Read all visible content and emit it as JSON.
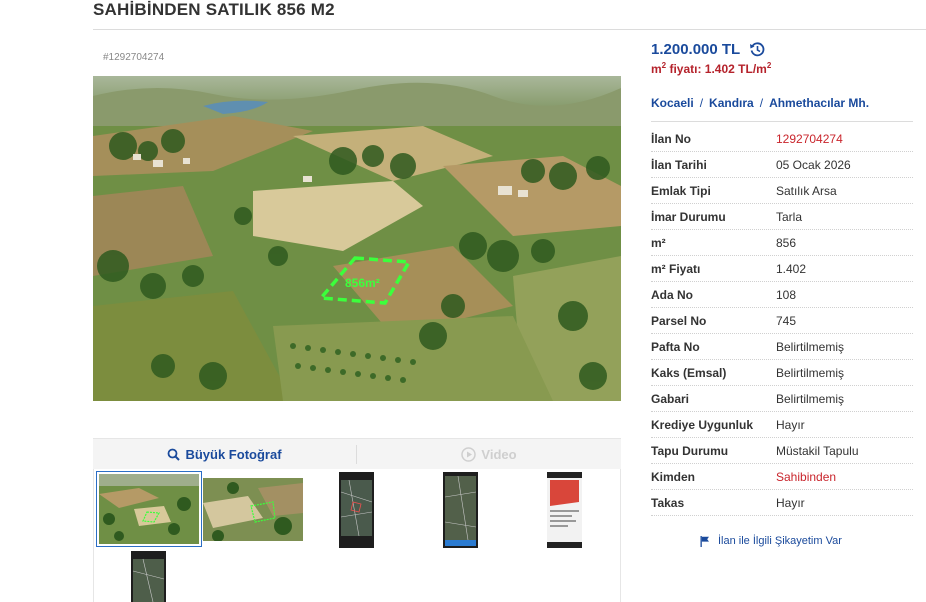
{
  "listing": {
    "title": "SAHİBİNDEN SATILIK 856 M2",
    "code": "#1292704274"
  },
  "photo": {
    "overlay_label": "856m²",
    "description_icon": "aerial-land-photo"
  },
  "media": {
    "photo_button": "Büyük Fotoğraf",
    "video_button": "Video",
    "photo_icon": "search-icon",
    "video_icon": "play-circle-icon"
  },
  "thumbnails": [
    {
      "kind": "aerial",
      "selected": true
    },
    {
      "kind": "aerial-closeup",
      "selected": false
    },
    {
      "kind": "phone-map",
      "selected": false
    },
    {
      "kind": "phone-map",
      "selected": false
    },
    {
      "kind": "phone-parcel",
      "selected": false
    },
    {
      "kind": "phone-map",
      "selected": false
    }
  ],
  "price": {
    "amount": "1.200.000 TL",
    "history_icon": "history-icon",
    "sqm_prefix": "m",
    "sqm_sup": "2",
    "sqm_text": " fiyatı: 1.402 TL/m",
    "sqm_sup2": "2"
  },
  "location": {
    "city": "Kocaeli",
    "district": "Kandıra",
    "neighborhood": "Ahmethacılar Mh.",
    "separator": "/"
  },
  "details": [
    {
      "label": "İlan No",
      "value": "1292704274",
      "highlight": true
    },
    {
      "label": "İlan Tarihi",
      "value": "05 Ocak 2026",
      "highlight": false
    },
    {
      "label": "Emlak Tipi",
      "value": "Satılık Arsa",
      "highlight": false
    },
    {
      "label": "İmar Durumu",
      "value": "Tarla",
      "highlight": false
    },
    {
      "label": "m²",
      "value": "856",
      "highlight": false
    },
    {
      "label": "m² Fiyatı",
      "value": "1.402",
      "highlight": false
    },
    {
      "label": "Ada No",
      "value": "108",
      "highlight": false
    },
    {
      "label": "Parsel No",
      "value": "745",
      "highlight": false
    },
    {
      "label": "Pafta No",
      "value": "Belirtilmemiş",
      "highlight": false
    },
    {
      "label": "Kaks (Emsal)",
      "value": "Belirtilmemiş",
      "highlight": false
    },
    {
      "label": "Gabari",
      "value": "Belirtilmemiş",
      "highlight": false
    },
    {
      "label": "Krediye Uygunluk",
      "value": "Hayır",
      "highlight": false
    },
    {
      "label": "Tapu Durumu",
      "value": "Müstakil Tapulu",
      "highlight": false
    },
    {
      "label": "Kimden",
      "value": "Sahibinden",
      "highlight": true
    },
    {
      "label": "Takas",
      "value": "Hayır",
      "highlight": false
    }
  ],
  "complaint": {
    "text": "İlan ile İlgili Şikayetim Var",
    "icon": "flag-icon"
  },
  "colors": {
    "brand_blue": "#1a4a9c",
    "accent_red": "#c9252c",
    "price_red": "#b5222b",
    "parcel_outline": "#3cff3c"
  }
}
